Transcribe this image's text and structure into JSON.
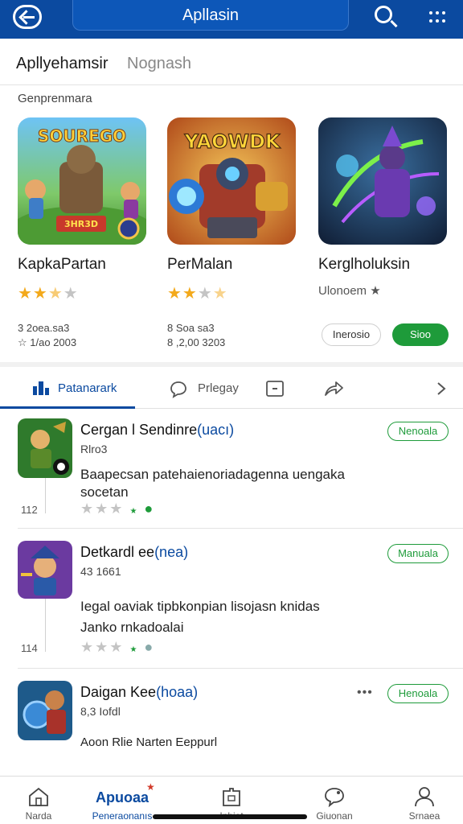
{
  "colors": {
    "brand": "#0b4aa0",
    "green": "#1e9b3a",
    "star": "#f3a91b"
  },
  "topbar": {
    "title": "Apllasin",
    "back_icon": "back-arrow-icon",
    "search_icon": "search-icon",
    "more_icon": "grid-dots-icon"
  },
  "heading": {
    "primary": "Apllyehamsir",
    "secondary": "Nognash"
  },
  "featured": {
    "label": "Genprenmara",
    "cards": [
      {
        "art_title": "SOUREGO",
        "art_badge": "3HR3D",
        "name": "KapkaPartan",
        "stars": "★★★★",
        "rating": 2.5,
        "meta1": "3 2oea.sa3",
        "meta2": "☆ 1/ao 2003"
      },
      {
        "art_title": "YAOWDK",
        "name": "PerMalan",
        "stars": "★★★★",
        "rating": 2,
        "meta1": "8 Soa sa3",
        "meta2": "8 ,2,00 3203"
      },
      {
        "name": "Kerglholuksin",
        "sub": "Ulonoem ★",
        "button_outline": "Inerosio",
        "button_green": "Sioo"
      }
    ]
  },
  "tabs": [
    {
      "label": "Patanarark",
      "icon": "home-chart-icon"
    },
    {
      "label": "Prlegay",
      "icon": "chat-bubble-icon"
    },
    {
      "label": "",
      "icon": "message-box-icon"
    },
    {
      "label": "",
      "icon": "share-icon"
    },
    {
      "label": "",
      "icon": "chevron-right-icon"
    }
  ],
  "list": [
    {
      "title": "Cergan l Sendinre",
      "title_accent": "(uacı)",
      "sub": "Rlro3",
      "desc1": "Baapecsan patehaienoriadagenna uengaka",
      "desc2": "socetan",
      "count": "112",
      "stars": "★★★",
      "button": "Nenoala"
    },
    {
      "title": "Detkardl ee",
      "title_accent": "(nea)",
      "sub": "43 1661",
      "desc1": "Iegal oaviak tipbkonpian lisojasn knidas",
      "desc2": "Janko rnkadoalai",
      "count": "114",
      "stars": "★★★",
      "button": "Manuala"
    },
    {
      "title": "Daigan Kee",
      "title_accent": "(hoaa)",
      "sub": "8,3 Iofdl",
      "footer": "Aoon  Rlie  Narten Eeppurl",
      "button": "Henoala"
    }
  ],
  "bottom_nav": [
    {
      "label": "Narda",
      "icon": "home-icon"
    },
    {
      "label": "Peneraonanıs",
      "brand": "Apuoaa",
      "icon": "brand-logo-icon"
    },
    {
      "label": "Inbiet",
      "icon": "puzzle-icon"
    },
    {
      "label": "Giuonan",
      "icon": "chat-icon"
    },
    {
      "label": "Srnaea",
      "icon": "user-icon"
    }
  ]
}
